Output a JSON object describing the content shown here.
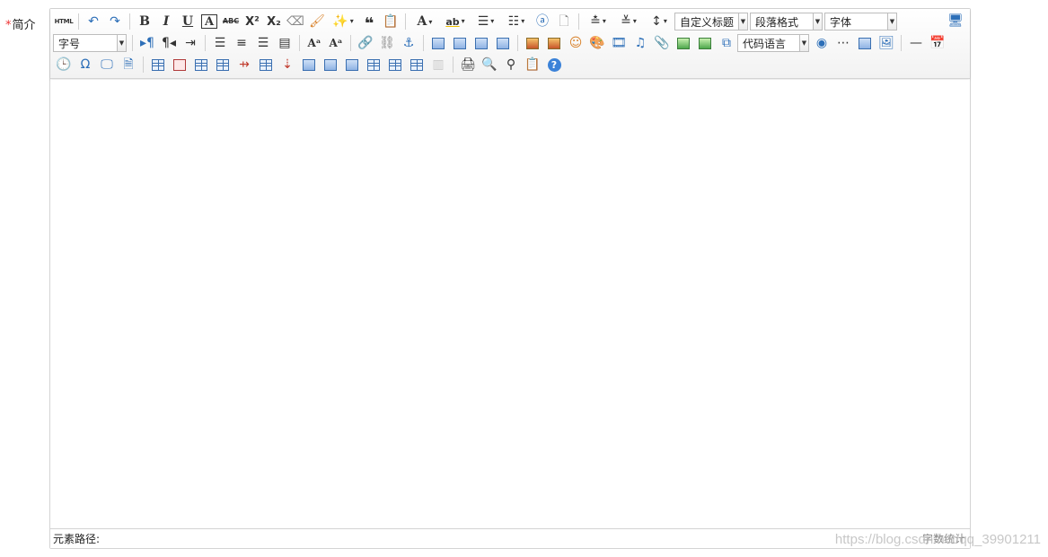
{
  "field": {
    "required_mark": "*",
    "label": "简介"
  },
  "toolbar": {
    "html_label": "HTML",
    "bold": "B",
    "italic": "I",
    "underline": "U",
    "fontborder": "A",
    "strike": "ABC",
    "superscript": "X²",
    "subscript": "X₂",
    "quote": "❝",
    "forecolor": "A",
    "custom_heading": "自定义标题",
    "paragraph_format": "段落格式",
    "font_family": "字体",
    "font_size": "字号",
    "code_language": "代码语言"
  },
  "status": {
    "element_path": "元素路径:",
    "word_count": "字数统计"
  },
  "watermark": "https://blog.csdn.net/qq_39901211"
}
